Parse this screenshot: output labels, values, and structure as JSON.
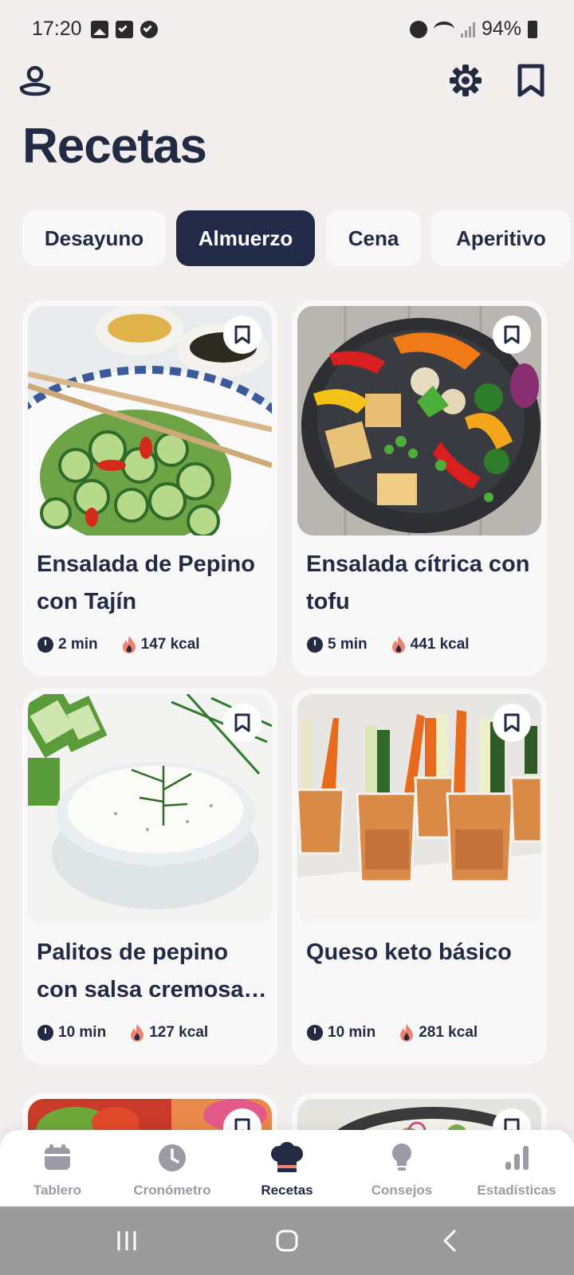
{
  "status_bar": {
    "time": "17:20",
    "battery": "94%"
  },
  "page_title": "Recetas",
  "tabs": [
    {
      "label": "Desayuno",
      "active": false
    },
    {
      "label": "Almuerzo",
      "active": true
    },
    {
      "label": "Cena",
      "active": false
    },
    {
      "label": "Aperitivo",
      "active": false
    }
  ],
  "recipes": [
    {
      "title": "Ensalada de Pepino con Tajín",
      "time": "2 min",
      "kcal": "147 kcal"
    },
    {
      "title": "Ensalada cítrica con tofu",
      "time": "5 min",
      "kcal": "441 kcal"
    },
    {
      "title": "Palitos de pepino con salsa cremosa…",
      "time": "10 min",
      "kcal": "127 kcal"
    },
    {
      "title": "Queso keto básico",
      "time": "10 min",
      "kcal": "281 kcal"
    }
  ],
  "bottom_nav": [
    {
      "label": "Tablero",
      "icon": "calendar-icon"
    },
    {
      "label": "Cronómetro",
      "icon": "clock-icon"
    },
    {
      "label": "Recetas",
      "icon": "chef-hat-icon",
      "active": true
    },
    {
      "label": "Consejos",
      "icon": "lightbulb-icon"
    },
    {
      "label": "Estadísticas",
      "icon": "bar-chart-icon"
    }
  ],
  "colors": {
    "primary": "#222a44",
    "background": "#f3eeee",
    "card": "#f9f8f8",
    "inactive": "#9b9ba5",
    "accent_flame": "#f08070",
    "chef_hat_band": "#f08070"
  }
}
